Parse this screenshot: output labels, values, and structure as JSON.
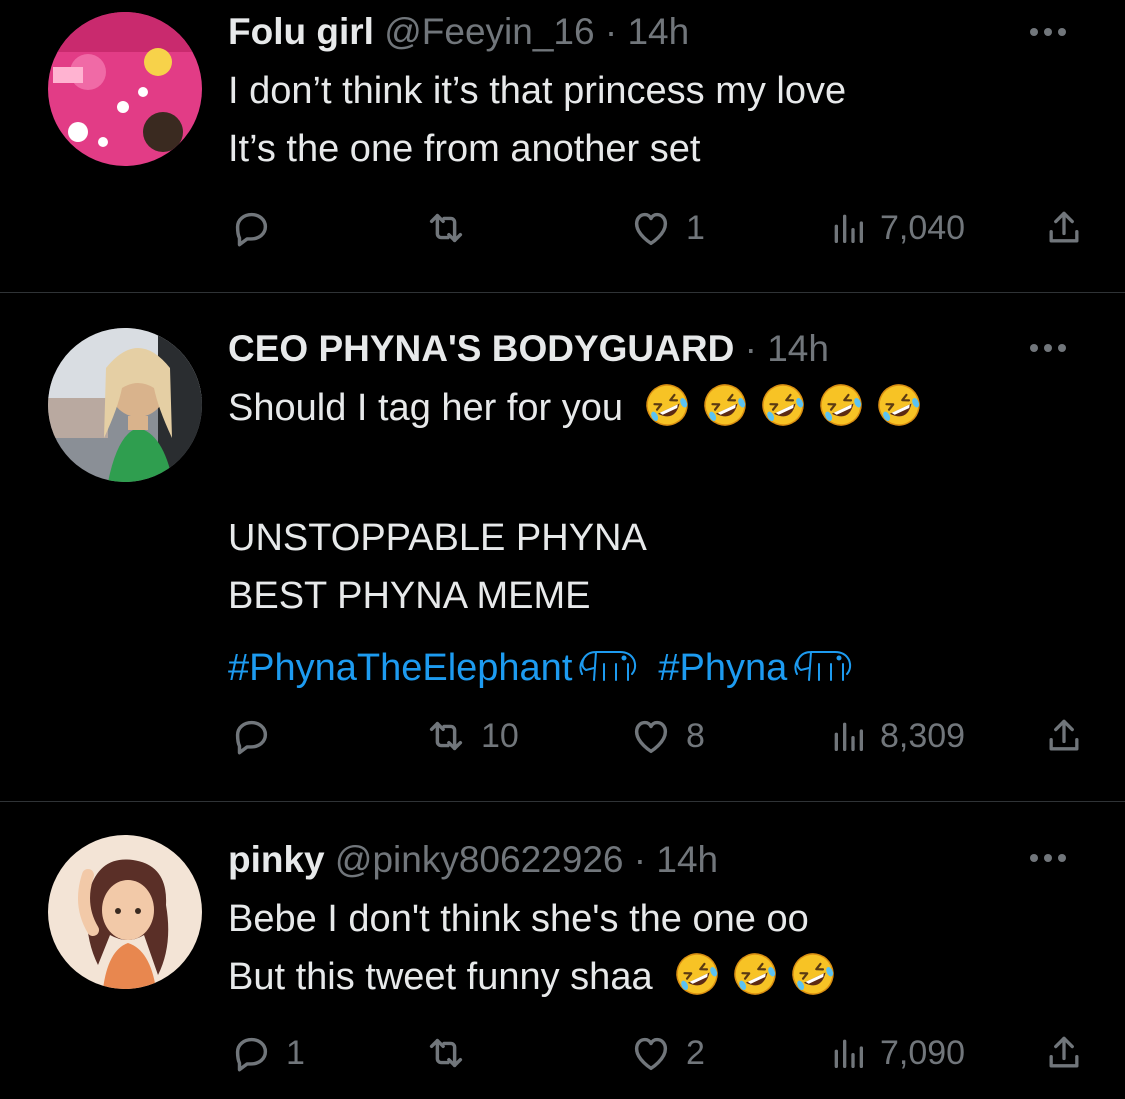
{
  "colors": {
    "background": "#000000",
    "text": "#e7e9ea",
    "muted": "#71767b",
    "link": "#1d9bf0",
    "divider": "#2f3336"
  },
  "tweets": [
    {
      "name": "Folu girl",
      "handle": "@Feeyin_16",
      "separator": "·",
      "time": "14h",
      "lines": [
        "I don’t think it’s that princess my love",
        "It’s the one from another set"
      ],
      "emoji_icon": "",
      "hashtags": [],
      "replies": "",
      "retweets": "",
      "likes": "1",
      "views": "7,040"
    },
    {
      "name": "CEO PHYNA'S BODYGUARD",
      "handle": "",
      "separator": "·",
      "time": "14h",
      "lines": [
        "Should I tag her for you",
        "",
        "UNSTOPPABLE PHYNA",
        "BEST PHYNA MEME"
      ],
      "emoji_icon": "rolling-on-floor-laughing-emoji",
      "emoji_count": 5,
      "hashtags": [
        "#PhynaTheElephant",
        "#Phyna"
      ],
      "hashtag_icon": "elephant-icon",
      "replies": "",
      "retweets": "10",
      "likes": "8",
      "views": "8,309"
    },
    {
      "name": "pinky",
      "handle": "@pinky80622926",
      "separator": "·",
      "time": "14h",
      "lines": [
        "Bebe I don't think she's the one oo",
        "But this tweet funny shaa"
      ],
      "emoji_icon": "rolling-on-floor-laughing-emoji",
      "emoji_count": 3,
      "hashtags": [],
      "replies": "1",
      "retweets": "",
      "likes": "2",
      "views": "7,090"
    }
  ]
}
